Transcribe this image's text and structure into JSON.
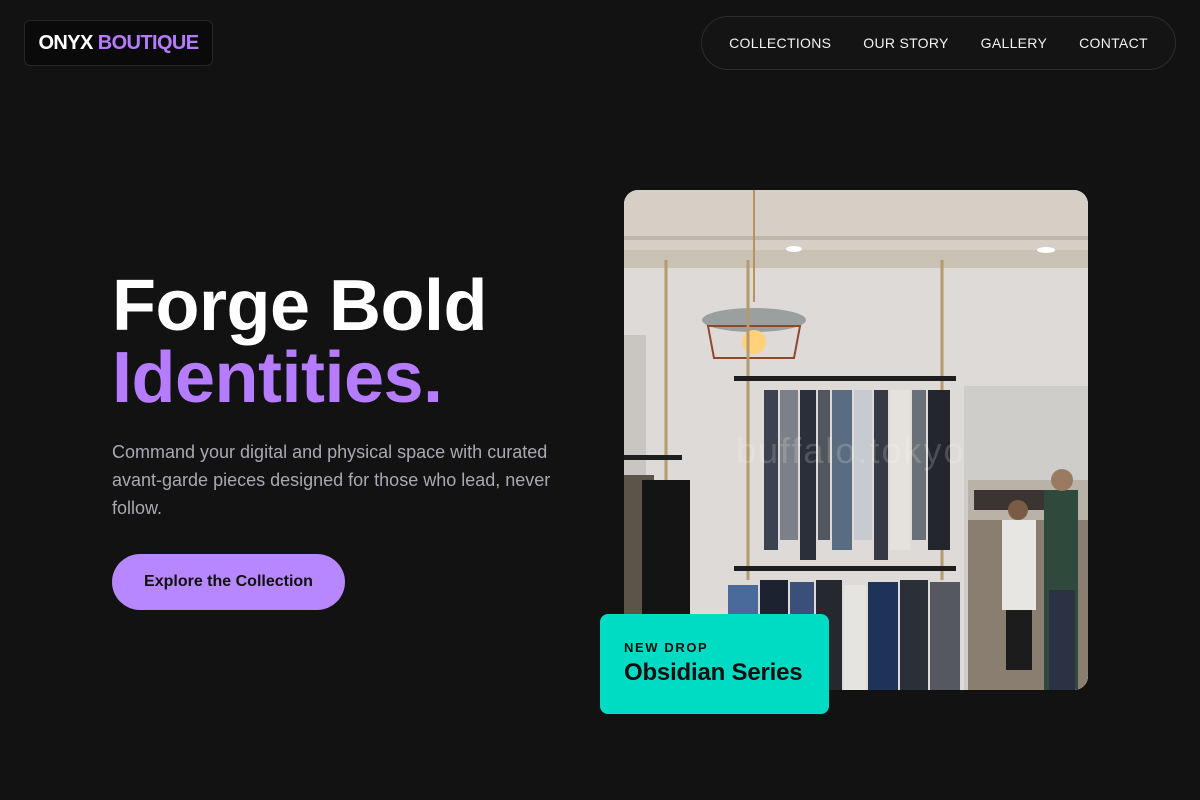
{
  "brand": {
    "part1": "ONYX",
    "part2": "BOUTIQUE"
  },
  "nav": [
    {
      "label": "COLLECTIONS"
    },
    {
      "label": "OUR STORY"
    },
    {
      "label": "GALLERY"
    },
    {
      "label": "CONTACT"
    }
  ],
  "hero": {
    "title_line1": "Forge Bold",
    "title_line2": "Identities.",
    "description": "Command your digital and physical space with curated avant-garde pieces designed for those who lead, never follow.",
    "cta_label": "Explore the Collection"
  },
  "image": {
    "watermark": "buffalo.tokyo"
  },
  "badge": {
    "kicker": "NEW DROP",
    "title": "Obsidian Series"
  },
  "colors": {
    "background": "#121212",
    "accent": "#b57cff",
    "badge": "#00dcc4"
  }
}
